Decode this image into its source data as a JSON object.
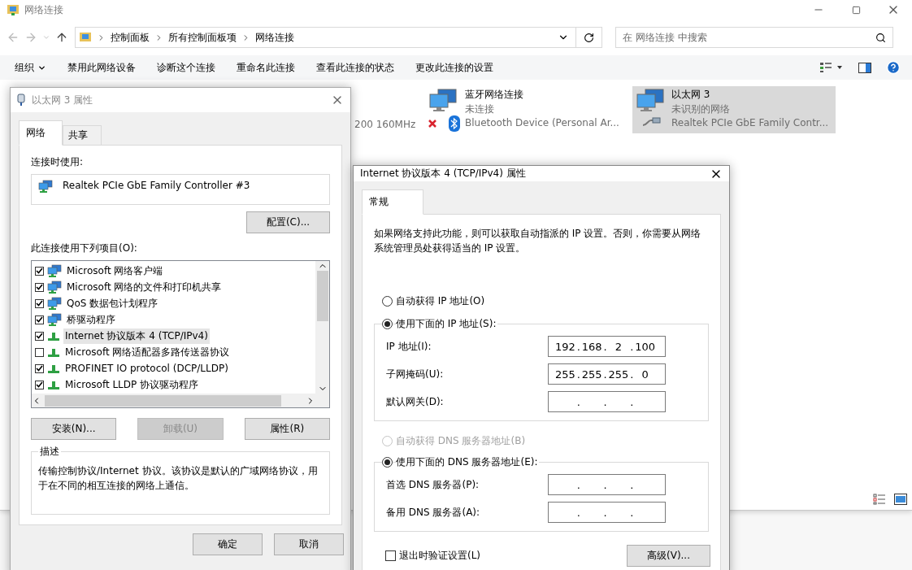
{
  "window": {
    "title": "网络连接"
  },
  "address": {
    "breadcrumb": [
      "控制面板",
      "所有控制面板项",
      "网络连接"
    ],
    "search_placeholder": "在 网络连接 中搜索"
  },
  "toolbar": [
    {
      "label": "组织",
      "kind": "menu"
    },
    {
      "label": "禁用此网络设备",
      "kind": "action"
    },
    {
      "label": "诊断这个连接",
      "kind": "action"
    },
    {
      "label": "重命名此连接",
      "kind": "action"
    },
    {
      "label": "查看此连接的状态",
      "kind": "action"
    },
    {
      "label": "更改此连接的设置",
      "kind": "action"
    }
  ],
  "hidden_item_text": "200 160MHz",
  "connections": [
    {
      "name": "蓝牙网络连接",
      "status": "未连接",
      "device": "Bluetooth Device (Personal Ar...",
      "kind": "bluetooth",
      "selected": false
    },
    {
      "name": "以太网 3",
      "status": "未识别的网络",
      "device": "Realtek PCIe GbE Family Contr...",
      "kind": "ethernet",
      "selected": true
    }
  ],
  "ethernet_dialog": {
    "title": "以太网 3 属性",
    "tabs": [
      {
        "label": "网络",
        "selected": true
      },
      {
        "label": "共享",
        "selected": false
      }
    ],
    "connect_using_label": "连接时使用:",
    "adapter": "Realtek PCIe GbE Family Controller #3",
    "configure_button": "配置(C)...",
    "items_label": "此连接使用下列项目(O):",
    "items": [
      {
        "label": "Microsoft 网络客户端",
        "checked": true,
        "selected": false,
        "kind": "client"
      },
      {
        "label": "Microsoft 网络的文件和打印机共享",
        "checked": true,
        "selected": false,
        "kind": "client"
      },
      {
        "label": "QoS 数据包计划程序",
        "checked": true,
        "selected": false,
        "kind": "client"
      },
      {
        "label": "桥驱动程序",
        "checked": true,
        "selected": false,
        "kind": "client"
      },
      {
        "label": "Internet 协议版本 4 (TCP/IPv4)",
        "checked": true,
        "selected": true,
        "kind": "protocol"
      },
      {
        "label": "Microsoft 网络适配器多路传送器协议",
        "checked": false,
        "selected": false,
        "kind": "protocol"
      },
      {
        "label": "PROFINET IO protocol (DCP/LLDP)",
        "checked": true,
        "selected": false,
        "kind": "protocol"
      },
      {
        "label": "Microsoft LLDP 协议驱动程序",
        "checked": true,
        "selected": false,
        "kind": "protocol"
      }
    ],
    "buttons": [
      {
        "label": "安装(N)...",
        "disabled": false
      },
      {
        "label": "卸载(U)",
        "disabled": true
      },
      {
        "label": "属性(R)",
        "disabled": false
      }
    ],
    "description_label": "描述",
    "description": "传输控制协议/Internet 协议。该协议是默认的广域网络协议，用于在不同的相互连接的网络上通信。",
    "ok": "确定",
    "cancel": "取消"
  },
  "ipv4_dialog": {
    "title": "Internet 协议版本 4 (TCP/IPv4) 属性",
    "tabs": [
      {
        "label": "常规",
        "selected": true
      }
    ],
    "intro": "如果网络支持此功能，则可以获取自动指派的 IP 设置。否则，你需要从网络系统管理员处获得适当的 IP 设置。",
    "separator": ".",
    "ip_modes": [
      {
        "label": "自动获得 IP 地址(O)",
        "selected": false,
        "disabled": false
      },
      {
        "label": "使用下面的 IP 地址(S):",
        "selected": true,
        "disabled": false
      }
    ],
    "ip_fields": [
      {
        "label": "IP 地址(I):",
        "octets": [
          "192",
          "168",
          "2",
          "100"
        ]
      },
      {
        "label": "子网掩码(U):",
        "octets": [
          "255",
          "255",
          "255",
          "0"
        ]
      },
      {
        "label": "默认网关(D):"
      }
    ],
    "dns_modes": [
      {
        "label": "自动获得 DNS 服务器地址(B)",
        "selected": false,
        "disabled": true
      },
      {
        "label": "使用下面的 DNS 服务器地址(E):",
        "selected": true,
        "disabled": false
      }
    ],
    "dns_fields": [
      {
        "label": "首选 DNS 服务器(P):"
      },
      {
        "label": "备用 DNS 服务器(A):"
      }
    ],
    "validate_on_exit": {
      "label": "退出时验证设置(L)",
      "checked": false
    },
    "advanced_button": "高级(V)..."
  }
}
